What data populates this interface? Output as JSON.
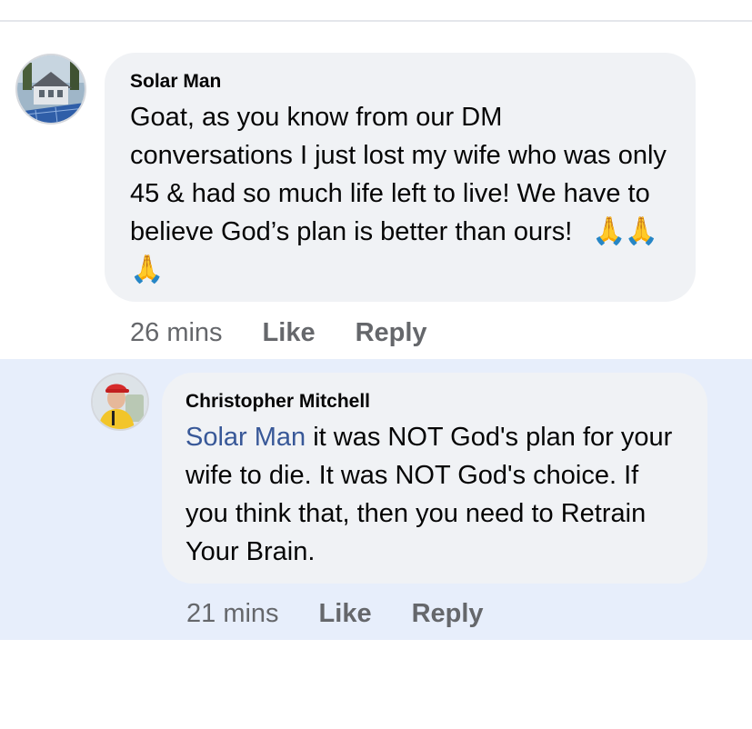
{
  "comments": [
    {
      "author": "Solar Man",
      "text": "Goat, as you know from our DM conversations I just lost my wife who was only 45 & had so much life left to live!  We have to believe God’s plan is better than ours!",
      "emoji": "🙏🙏🙏",
      "time": "26 mins",
      "like_label": "Like",
      "reply_label": "Reply"
    },
    {
      "author": "Christopher Mitchell",
      "mention": "Solar Man",
      "text": " it was NOT God's plan for your wife to die. It was NOT God's choice. If you think that, then you need to Retrain Your Brain.",
      "time": "21 mins",
      "like_label": "Like",
      "reply_label": "Reply"
    }
  ],
  "colors": {
    "bubble": "#f0f2f5",
    "reply_highlight": "#e7eefb",
    "mention": "#385898",
    "meta": "#65676b"
  },
  "icons": {
    "avatar_1": "house-solar-panels-avatar",
    "avatar_2": "man-red-cap-avatar"
  }
}
